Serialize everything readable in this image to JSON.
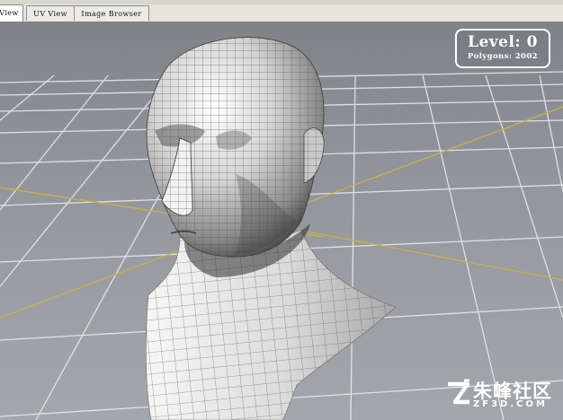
{
  "tabs": [
    {
      "label": "View",
      "active": true
    },
    {
      "label": "UV View",
      "active": false
    },
    {
      "label": "Image Browser",
      "active": false
    }
  ],
  "hud": {
    "level": "Level: 0",
    "polygons": "Polygons: 2002"
  },
  "watermark": {
    "name": "朱峰社区",
    "site": "ZF3D.COM"
  },
  "colors": {
    "background": "#8d9196",
    "grid": "#e9ebee",
    "axis": "#c7ad5a",
    "mesh_wire": "#4a4a4a"
  }
}
